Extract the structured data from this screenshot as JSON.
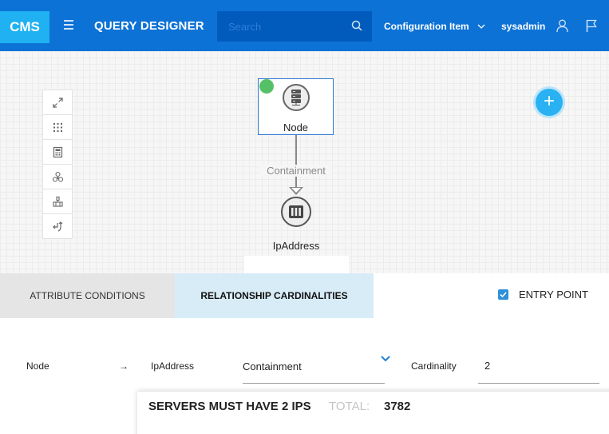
{
  "header": {
    "logo": "CMS",
    "title": "QUERY DESIGNER",
    "search_placeholder": "Search",
    "ci_type": "Configuration Item",
    "username": "sysadmin"
  },
  "graph": {
    "nodes": [
      {
        "label": "Node",
        "icon": "server-icon"
      },
      {
        "label": "IpAddress",
        "icon": "ip-address-icon"
      }
    ],
    "edge_label": "Containment"
  },
  "toolbar": {
    "icons": [
      "expand-icon",
      "grid-icon",
      "calculator-icon",
      "hierarchy-icon",
      "layout-icon",
      "reroute-icon"
    ]
  },
  "tabs": [
    {
      "label": "ATTRIBUTE CONDITIONS",
      "active": false
    },
    {
      "label": "RELATIONSHIP CARDINALITIES",
      "active": true
    }
  ],
  "entry_point": {
    "label": "ENTRY POINT",
    "checked": true
  },
  "relationship": {
    "from": "Node",
    "arrow": "→",
    "to": "IpAddress",
    "type": "Containment",
    "cardinality_label": "Cardinality",
    "cardinality_value": "2"
  },
  "result_panel": {
    "title": "SERVERS MUST HAVE 2 IPS",
    "total_label": "TOTAL:",
    "total_value": "3782"
  },
  "colors": {
    "header": "#0d72d6",
    "logo": "#1fb1f2",
    "accent": "#29b1f2",
    "selected_node_border": "#2a78d2",
    "status_dot": "#56c066"
  }
}
